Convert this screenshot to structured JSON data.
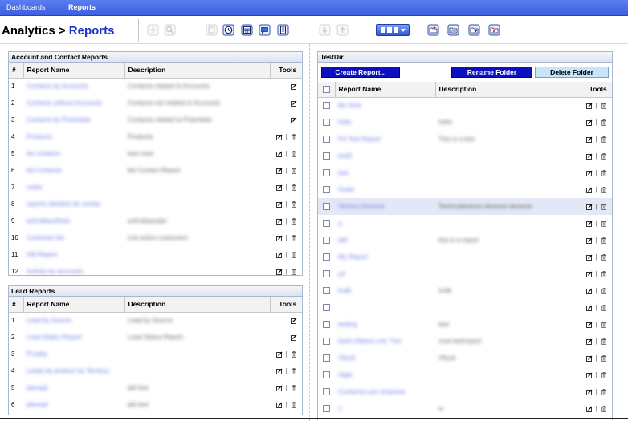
{
  "nav": {
    "dashboards": "Dashboards",
    "reports": "Reports"
  },
  "title": {
    "prefix": "Analytics > ",
    "crumb": "Reports"
  },
  "left_top": {
    "title": "Account and Contact Reports",
    "columns": [
      "#",
      "Report Name",
      "Description",
      "Tools"
    ],
    "rows": [
      {
        "n": "1",
        "name": "Contacts by Accounts",
        "desc": "Contacts related to Accounts",
        "del": false
      },
      {
        "n": "2",
        "name": "Contacts without Accounts",
        "desc": "Contacts not related to Accounts",
        "del": false
      },
      {
        "n": "3",
        "name": "Contacts by Potentials",
        "desc": "Contacts related to Potentials",
        "del": false
      },
      {
        "n": "4",
        "name": "Products",
        "desc": "Products",
        "del": true
      },
      {
        "n": "5",
        "name": "list contacts",
        "desc": "test rows",
        "del": true
      },
      {
        "n": "6",
        "name": "list Contacts",
        "desc": "list Contact Report",
        "del": true
      },
      {
        "n": "7",
        "name": "cedar",
        "desc": "",
        "del": true
      },
      {
        "n": "8",
        "name": "reports detailed de ventas",
        "desc": "",
        "del": true
      },
      {
        "n": "9",
        "name": "anfroblasofindo",
        "desc": "anfroblasobel",
        "del": true
      },
      {
        "n": "10",
        "name": "Customer list",
        "desc": "List active customers",
        "del": true
      },
      {
        "n": "11",
        "name": "AM Report",
        "desc": "",
        "del": true
      },
      {
        "n": "12",
        "name": "Activity by accounts",
        "desc": "",
        "del": true
      }
    ]
  },
  "left_bottom": {
    "title": "Lead Reports",
    "columns": [
      "#",
      "Report Name",
      "Description",
      "Tools"
    ],
    "rows": [
      {
        "n": "1",
        "name": "Lead by Source",
        "desc": "Lead by Source",
        "del": false
      },
      {
        "n": "2",
        "name": "Lead Status Report",
        "desc": "Lead Status Report",
        "del": false
      },
      {
        "n": "3",
        "name": "Prueba",
        "desc": "",
        "del": true
      },
      {
        "n": "4",
        "name": "Leads by product by Territory",
        "desc": "",
        "del": true
      },
      {
        "n": "5",
        "name": "pbrespt",
        "desc": "pbl test",
        "del": true
      },
      {
        "n": "6",
        "name": "pbrespt",
        "desc": "pbl test",
        "del": true
      }
    ]
  },
  "right": {
    "title": "TestDir",
    "buttons": {
      "create": "Create Report...",
      "rename": "Rename Folder",
      "delete": "Delete Folder"
    },
    "columns": [
      "Report Name",
      "Description",
      "Tools"
    ],
    "rows": [
      {
        "name": "ldc Host",
        "desc": ""
      },
      {
        "name": "hello",
        "desc": "hello"
      },
      {
        "name": "Prt Test Report",
        "desc": "This is a test"
      },
      {
        "name": "test5",
        "desc": ""
      },
      {
        "name": "test",
        "desc": ""
      },
      {
        "name": "Scale",
        "desc": ""
      },
      {
        "name": "Technu Deneme",
        "desc": "Technudeneme deneme deneme"
      },
      {
        "name": "a",
        "desc": ""
      },
      {
        "name": "ddf",
        "desc": "this is a report"
      },
      {
        "name": "My Report",
        "desc": ""
      },
      {
        "name": "yd",
        "desc": ""
      },
      {
        "name": "hrdb",
        "desc": "hrdb"
      },
      {
        "name": "",
        "desc": ""
      },
      {
        "name": "testing",
        "desc": "test"
      },
      {
        "name": "test5 (Status cnt) *Yes",
        "desc": "nvet test/report"
      },
      {
        "name": "Vfood",
        "desc": "Vfood"
      },
      {
        "name": "vfgat",
        "desc": ""
      },
      {
        "name": "Contactos por empresa",
        "desc": ""
      },
      {
        "name": "1",
        "desc": "w"
      }
    ]
  },
  "icons": {
    "edit": "edit-icon",
    "trash": "trash-icon",
    "toolbar": [
      "add-icon",
      "search-icon",
      "folder-icon",
      "clock-icon",
      "calendar-icon",
      "comment-icon",
      "document-icon",
      "arrow-down-icon",
      "arrow-up-icon",
      "folder-new-icon",
      "folder-open-icon",
      "folder-add-icon",
      "folder-delete-icon"
    ]
  },
  "colors": {
    "nav": "#3c5fe0",
    "link": "#1f34c8",
    "button_dark": "#0c10c0",
    "button_light": "#c8e4f8"
  }
}
